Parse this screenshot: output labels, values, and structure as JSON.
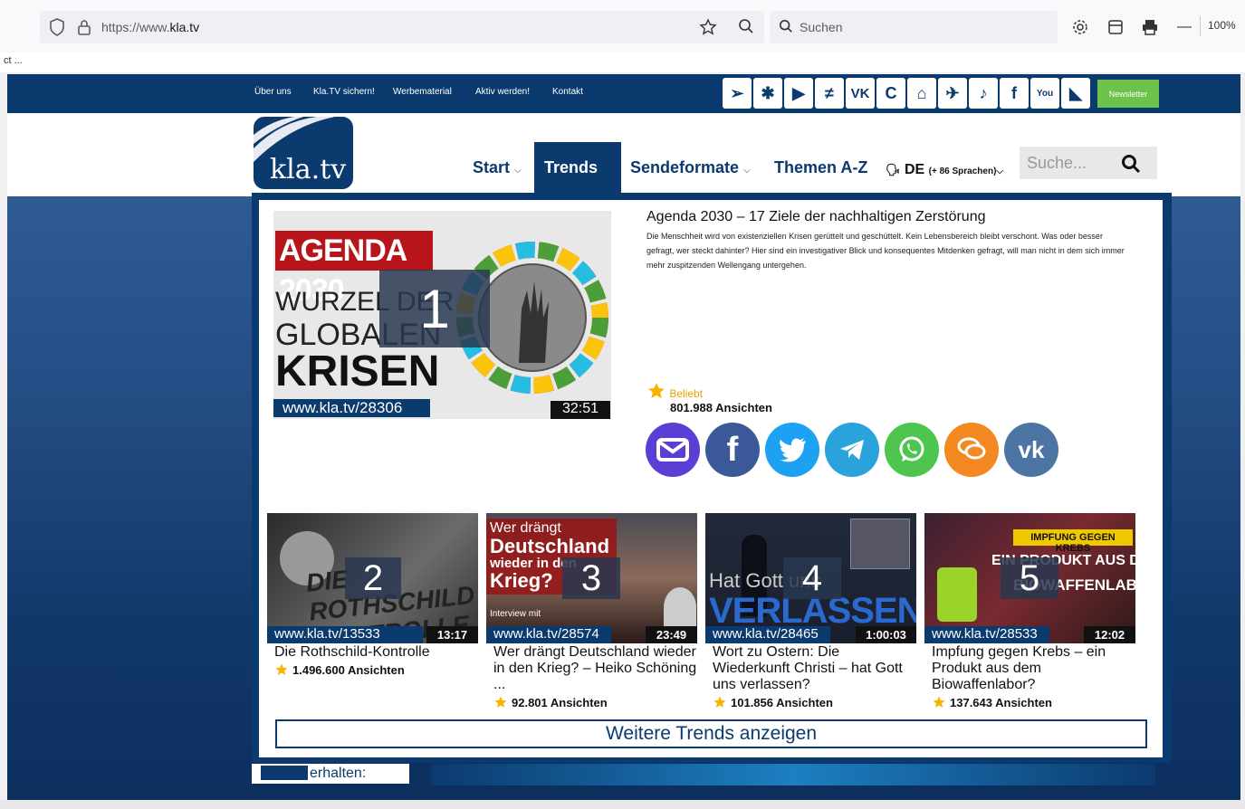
{
  "browser": {
    "url_prefix": "https://www.",
    "url_domain": "kla.tv",
    "search_placeholder": "Suchen",
    "zoom": "100%",
    "tab_fragment": "ct ..."
  },
  "topnav": {
    "links": [
      "Über uns",
      "Kla.TV sichern!",
      "Werbematerial",
      "Aktiv werden!",
      "Kontakt"
    ],
    "newsletter": "Newsletter"
  },
  "logo_text": "kla.tv",
  "mainnav": {
    "start": "Start",
    "trends": "Trends",
    "sendeformate": "Sendeformate",
    "themen": "Themen A-Z",
    "lang": "DE",
    "lang_more": "(+ 86 Sprachen)",
    "search_placeholder": "Suche..."
  },
  "featured": {
    "rank": "1",
    "banner": "AGENDA 2030",
    "line1": "WURZEL DER",
    "line2": "GLOBALEN",
    "line3": "KRISEN",
    "url": "www.kla.tv/28306",
    "duration": "32:51",
    "title": "Agenda 2030 – 17 Ziele der nachhaltigen Zerstörung",
    "description": "Die Menschheit wird von existenziellen Krisen gerüttelt und geschüttelt. Kein Lebensbereich bleibt verschont. Was oder besser gefragt, wer steckt dahinter? Hier sind ein investigativer Blick und konsequentes Mitdenken gefragt, will man nicht in dem sich immer mehr zuspitzenden Wellengang untergehen.",
    "badge": "Beliebt",
    "views": "801.988 Ansichten"
  },
  "cards": [
    {
      "rank": "2",
      "url": "www.kla.tv/13533",
      "duration": "13:17",
      "title": "Die Rothschild-Kontrolle",
      "views": "1.496.600 Ansichten",
      "overlay": "DIE ROTHSCHILD KONTROLLE"
    },
    {
      "rank": "3",
      "url": "www.kla.tv/28574",
      "duration": "23:49",
      "title": "Wer drängt Deutschland wieder in den Krieg? – Heiko Schöning ...",
      "views": "92.801 Ansichten",
      "overlay_a": "Wer drängt",
      "overlay_b": "Deutschland",
      "overlay_c": "wieder in den",
      "overlay_d": "Krieg?",
      "overlay_e": "Interview mit"
    },
    {
      "rank": "4",
      "url": "www.kla.tv/28465",
      "duration": "1:00:03",
      "title": "Wort zu Ostern: Die Wiederkunft Christi – hat Gott uns verlassen?",
      "views": "101.856 Ansichten",
      "overlay_a": "Hat Gott uns",
      "overlay_b": "VERLASSEN?"
    },
    {
      "rank": "5",
      "url": "www.kla.tv/28533",
      "duration": "12:02",
      "title": "Impfung gegen Krebs – ein Produkt aus dem Biowaffenlabor?",
      "views": "137.643 Ansichten",
      "overlay_a": "IMPFUNG GEGEN KREBS",
      "overlay_b": "EIN PRODUKT AUS DEM",
      "overlay_c": "BIOWAFFENLABOR?"
    }
  ],
  "more_button": "Weitere Trends anzeigen",
  "footer_text": "erhalten:"
}
